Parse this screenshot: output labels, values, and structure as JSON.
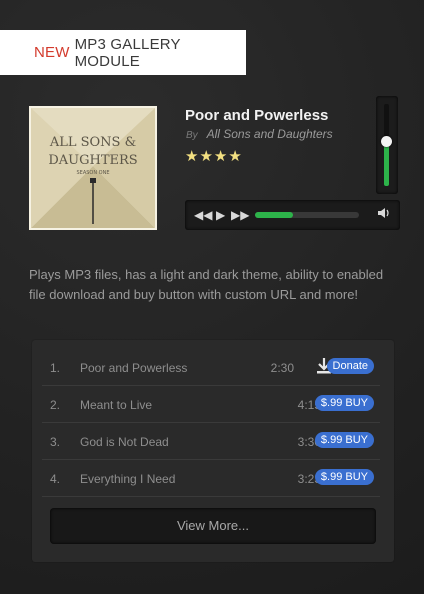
{
  "header": {
    "new_label": "NEW",
    "title": "MP3 GALLERY MODULE"
  },
  "player": {
    "track_title": "Poor and Powerless",
    "by_label": "By",
    "artist": "All Sons and Daughters",
    "rating_stars": 4,
    "rating_text": "★★★★",
    "volume_level": 0.55,
    "progress": 0.37,
    "icons": [
      "rewind-icon",
      "play-icon",
      "fast-forward-icon",
      "volume-icon"
    ],
    "accent_color": "#2db34a"
  },
  "album_art": {
    "line1": "ALL SONS &",
    "line2": "DAUGHTERS",
    "line3": "SEASON ONE"
  },
  "description": "Plays MP3 files, has a light and dark theme, ability to enabled file download and buy button with custom URL and more!",
  "playlist": {
    "tracks": [
      {
        "num": "1.",
        "title": "Poor and Powerless",
        "duration": "2:30",
        "action": "Donate",
        "download": true
      },
      {
        "num": "2.",
        "title": "Meant to Live",
        "duration": "4:15",
        "action": "$.99 BUY",
        "download": false
      },
      {
        "num": "3.",
        "title": "God is Not Dead",
        "duration": "3:30",
        "action": "$.99 BUY",
        "download": false
      },
      {
        "num": "4.",
        "title": "Everything I Need",
        "duration": "3:23",
        "action": "$.99 BUY",
        "download": false
      }
    ],
    "view_more": "View More...",
    "button_color": "#3a6fd0"
  }
}
